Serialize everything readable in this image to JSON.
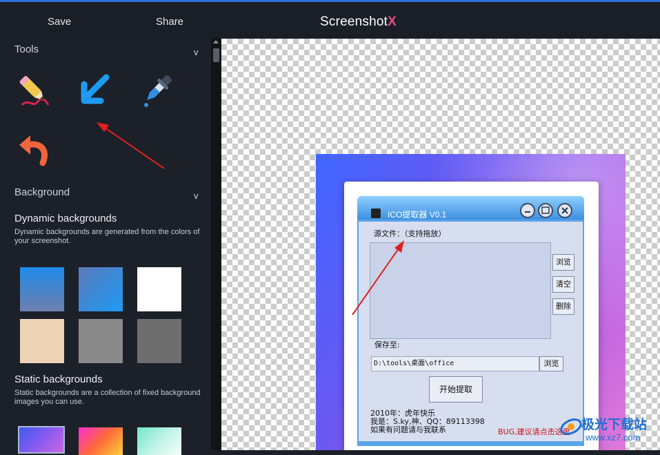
{
  "header": {
    "save_label": "Save",
    "share_label": "Share",
    "brand_text": "Screenshot",
    "brand_mark": "X"
  },
  "sidebar": {
    "tools_title": "Tools",
    "background_title": "Background",
    "chevron": "v",
    "tools": [
      "pencil-icon",
      "arrow-icon",
      "eyedropper-icon",
      "undo-icon"
    ],
    "dynamic": {
      "title": "Dynamic backgrounds",
      "desc": "Dynamic backgrounds are generated from the colors of your screenshot.",
      "swatches": [
        "#3a7bd5",
        "#1e90ff",
        "#ffffff",
        "#efd3b7",
        "#8a8a8a",
        "#6e6e6e"
      ]
    },
    "static": {
      "title": "Static backgrounds",
      "desc": "Static backgrounds are a collection of fixed background images you can use."
    }
  },
  "app": {
    "title": "ICO提取器 V0.1",
    "source_label": "源文件：（支持拖放）",
    "browse_label": "浏览",
    "clear_label": "清空",
    "delete_label": "删除",
    "saveto_label": "保存至:",
    "path_value": "D:\\tools\\桌面\\office",
    "path_browse_label": "浏览",
    "start_label": "开始提取",
    "info_line1": "2010年：虎年快乐",
    "info_line2": "我是：S.ky,神、QQ：89113398",
    "info_line3": "如果有问题请与我联系",
    "bug_link": "BUG,建议请点击这里"
  },
  "watermark": {
    "text1": "极光下载站",
    "text2": "www.xz7.com"
  },
  "colors": {
    "accent": "#2a6fd1",
    "annotation_arrow": "#e02020",
    "brand_x": "#e84a8a"
  }
}
